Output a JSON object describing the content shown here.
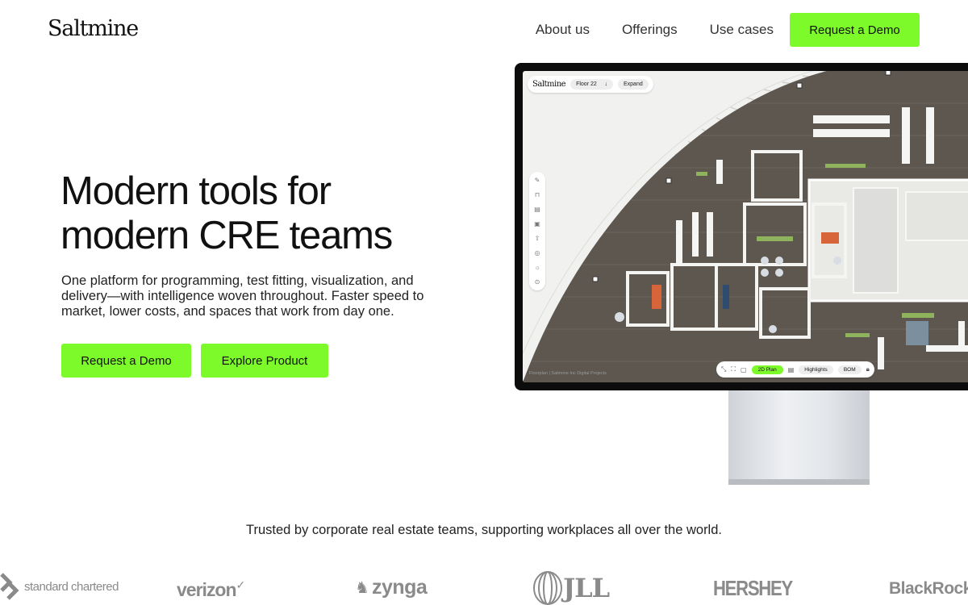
{
  "header": {
    "logo": "Saltmine",
    "nav": [
      "About us",
      "Offerings",
      "Use cases"
    ],
    "cta": "Request a Demo"
  },
  "hero": {
    "title_line1": "Modern tools for",
    "title_line2": "modern CRE teams",
    "subtitle": "One platform for programming, test fitting, visualization, and delivery—with intelligence woven throughout. Faster speed to market, lower costs, and spaces that work from day one.",
    "primary_cta": "Request a Demo",
    "secondary_cta": "Explore Product"
  },
  "app": {
    "logo": "Saltmine",
    "floor": "Floor 22",
    "floor_arrow": "↓",
    "expand": "Expand",
    "view_active": "2D Plan",
    "highlights": "Highlights",
    "bom": "BOM",
    "caption": "Floorplan | Saltmine Inc   Digital Projects"
  },
  "trust": {
    "text": "Trusted by corporate real estate teams, supporting workplaces all over the world.",
    "brands": [
      "standard chartered",
      "verizon",
      "zynga",
      "JLL",
      "HERSHEY",
      "BlackRock"
    ]
  },
  "colors": {
    "accent": "#7dfa2a",
    "floor": "#5d5750",
    "wall": "#f4f4f2",
    "orange": "#d8653a",
    "monitor": "#0c0c0c"
  }
}
